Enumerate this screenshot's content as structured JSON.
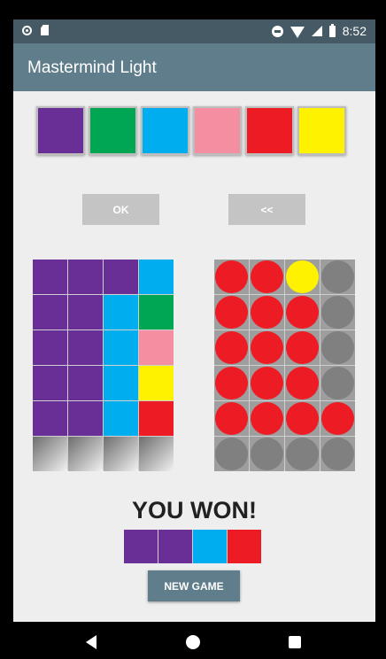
{
  "status_bar": {
    "time": "8:52",
    "left_icons": [
      "circle-icon",
      "sd-card-icon"
    ],
    "right_icons": [
      "do-not-disturb-icon",
      "wifi-icon",
      "signal-icon",
      "battery-icon"
    ]
  },
  "app_bar": {
    "title": "Mastermind Light"
  },
  "palette": [
    {
      "name": "purple",
      "color": "#6a2f96"
    },
    {
      "name": "green",
      "color": "#00a651"
    },
    {
      "name": "blue",
      "color": "#00aeef"
    },
    {
      "name": "pink",
      "color": "#f48fa1"
    },
    {
      "name": "red",
      "color": "#ed1c24"
    },
    {
      "name": "yellow",
      "color": "#fff200"
    }
  ],
  "buttons": {
    "ok": "OK",
    "back": "<<",
    "new_game": "NEW GAME"
  },
  "guesses": [
    [
      "purple",
      "purple",
      "purple",
      "blue"
    ],
    [
      "purple",
      "purple",
      "blue",
      "green"
    ],
    [
      "purple",
      "purple",
      "blue",
      "pink"
    ],
    [
      "purple",
      "purple",
      "blue",
      "yellow"
    ],
    [
      "purple",
      "purple",
      "blue",
      "red"
    ],
    [
      "empty",
      "empty",
      "empty",
      "empty"
    ]
  ],
  "scores": [
    [
      "red",
      "red",
      "yellow",
      "gray"
    ],
    [
      "red",
      "red",
      "red",
      "gray"
    ],
    [
      "red",
      "red",
      "red",
      "gray"
    ],
    [
      "red",
      "red",
      "red",
      "gray"
    ],
    [
      "red",
      "red",
      "red",
      "red"
    ],
    [
      "gray",
      "gray",
      "gray",
      "gray"
    ]
  ],
  "peg_colors": {
    "red": "#ed1c24",
    "yellow": "#fff200",
    "gray": "#808080"
  },
  "result": {
    "text": "YOU WON!"
  },
  "solution": [
    "purple",
    "purple",
    "blue",
    "red"
  ],
  "nav_bar": {
    "icons": [
      "back-icon",
      "home-icon",
      "recents-icon"
    ]
  }
}
